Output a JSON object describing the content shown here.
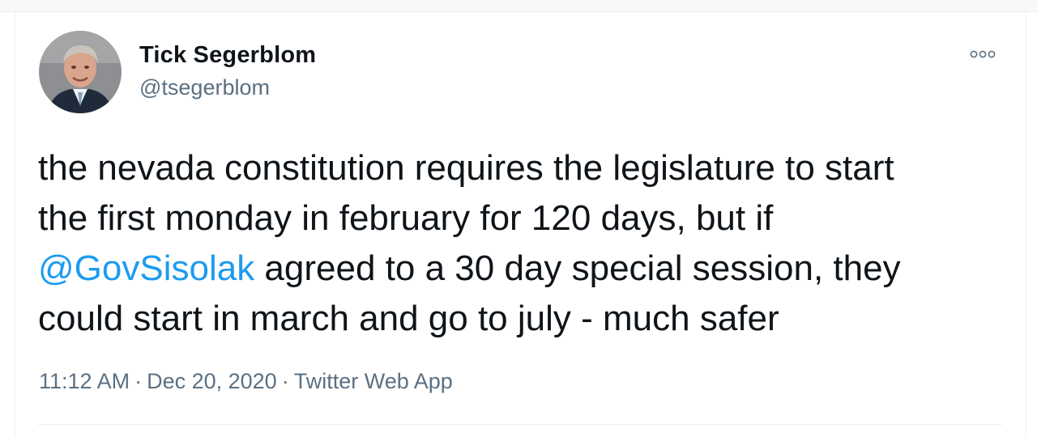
{
  "tweet": {
    "author": {
      "name": "Tick Segerblom",
      "handle": "@tsegerblom",
      "avatar_icon": "avatar-photo"
    },
    "more_icon": "more-options-icon",
    "text_lines": [
      {
        "before": "the nevada constitution requires the legislature to start",
        "mention": "",
        "after": ""
      },
      {
        "before": "the first monday in february for 120 days, but if",
        "mention": "",
        "after": ""
      },
      {
        "before": "",
        "mention": "@GovSisolak",
        "after": " agreed to a 30 day special session, they"
      },
      {
        "before": "could start in march and go to july - much safer",
        "mention": "",
        "after": ""
      }
    ],
    "meta": {
      "time": "11:12 AM",
      "separator": "·",
      "date": "Dec 20, 2020",
      "source": "Twitter Web App"
    }
  },
  "colors": {
    "text": "#0f1419",
    "secondary": "#5b7083",
    "link": "#1d9bf0"
  }
}
